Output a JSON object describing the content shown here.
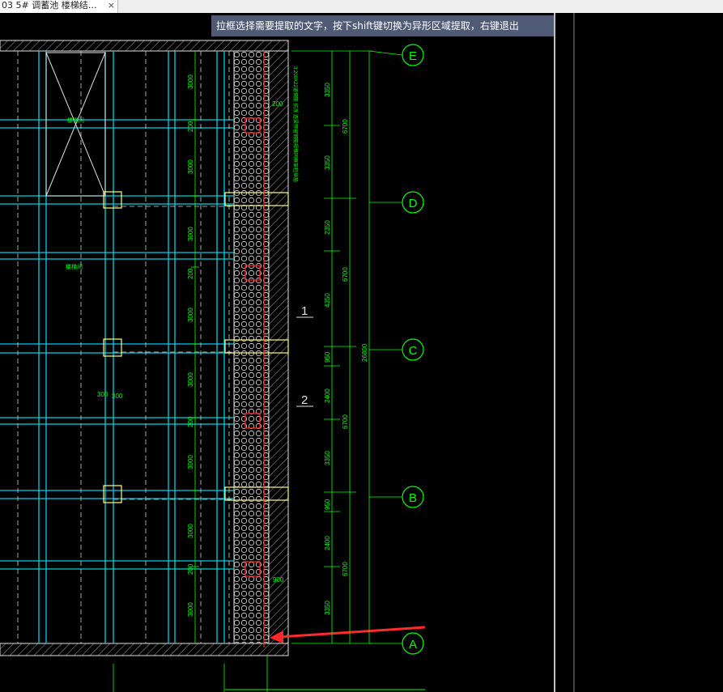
{
  "tab": {
    "title": "03 5# 调蓄池 楼梯结…",
    "close_glyph": "×"
  },
  "tooltip": {
    "text": "拉框选择需要提取的文字，按下shift键切换为异形区域提取，右键退出"
  },
  "colors": {
    "background": "#000000",
    "cyan": "#00d0e0",
    "green": "#00ff00",
    "white": "#e0e0e0",
    "red": "#ff2020",
    "yellow": "#ffff80",
    "tooltip_bg": "#4f5b75"
  },
  "drawing": {
    "axis_labels": [
      "E",
      "D",
      "C",
      "B",
      "A"
    ],
    "left_dims": [
      "3000",
      "3000",
      "3000",
      "3000",
      "3000",
      "3000",
      "3000",
      "3000"
    ],
    "small_dims": [
      "200",
      "200",
      "200",
      "200"
    ],
    "right_inner_dims": [
      "3350",
      "3350",
      "2350",
      "4350",
      "950",
      "2400",
      "3350",
      "950",
      "2400",
      "3350"
    ],
    "right_outer_dims": [
      "6700",
      "6700",
      "6700",
      "6700"
    ],
    "total_dim": "26800",
    "room_labels": [
      "楼梯间",
      "楼梯间"
    ],
    "section_marks": [
      "1",
      "2"
    ],
    "misc_dims": [
      "300",
      "300",
      "900",
      "200"
    ],
    "vertical_note": "3.200X22道钢筋  抗浮  连梁预留钢筋规格同框架柱纵筋"
  }
}
